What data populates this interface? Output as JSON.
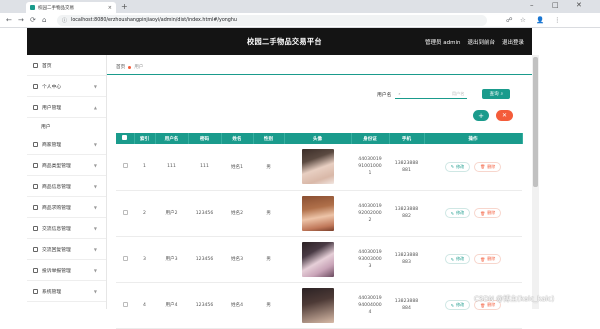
{
  "browser": {
    "tab_title": "校园二手物品交易",
    "tab_close": "×",
    "new_tab": "+",
    "window_controls": [
      "–",
      "□",
      "✕"
    ],
    "nav": [
      "←",
      "→",
      "⟳",
      "⌂"
    ],
    "lock": "ⓘ",
    "url": "localhost:8080/erzhoushangpinjiaoyi/admin/dist/index.html#/yonghu",
    "right_icons": [
      "☍",
      "☆",
      "👤",
      "⋮"
    ]
  },
  "header": {
    "title": "校园二手物品交易平台",
    "links": [
      "管理员 admin",
      "退出到前台",
      "退出登录"
    ]
  },
  "sidebar": {
    "items": [
      {
        "label": "首页",
        "has_chevron": false
      },
      {
        "label": "个人中心",
        "has_chevron": true
      },
      {
        "label": "用户管理",
        "has_chevron": true,
        "subitems": [
          "用户"
        ]
      },
      {
        "label": "商家管理",
        "has_chevron": true
      },
      {
        "label": "商品类型管理",
        "has_chevron": true
      },
      {
        "label": "商品信息管理",
        "has_chevron": true
      },
      {
        "label": "商品求购管理",
        "has_chevron": true
      },
      {
        "label": "交流信息管理",
        "has_chevron": true
      },
      {
        "label": "交流回复管理",
        "has_chevron": true
      },
      {
        "label": "投诉举报管理",
        "has_chevron": true
      },
      {
        "label": "系统管理",
        "has_chevron": true
      }
    ]
  },
  "breadcrumb": {
    "home": "首页",
    "current": "用户"
  },
  "search": {
    "label": "用户名",
    "placeholder": "用户名",
    "icon": "⌕",
    "button": "查询",
    "button_icon": "⌕"
  },
  "actions": {
    "add": "+",
    "delete": "✕"
  },
  "table": {
    "columns": [
      "",
      "索引",
      "用户名",
      "密码",
      "姓名",
      "性别",
      "头像",
      "身份证",
      "手机",
      "操作"
    ],
    "rows": [
      {
        "index": "1",
        "username": "111",
        "password": "111",
        "name": "姓名1",
        "gender": "男",
        "idcard": "44030019910010001",
        "phone": "13823888881",
        "avatar": "av1"
      },
      {
        "index": "2",
        "username": "用户2",
        "password": "123456",
        "name": "姓名2",
        "gender": "男",
        "idcard": "44030019920020002",
        "phone": "13823888882",
        "avatar": "av2"
      },
      {
        "index": "3",
        "username": "用户3",
        "password": "123456",
        "name": "姓名3",
        "gender": "男",
        "idcard": "44030019930030003",
        "phone": "13823888883",
        "avatar": "av3"
      },
      {
        "index": "4",
        "username": "用户4",
        "password": "123456",
        "name": "姓名4",
        "gender": "男",
        "idcard": "44030019940040004",
        "phone": "13823888884",
        "avatar": "av4"
      }
    ],
    "op_edit": "修改",
    "op_delete": "删除",
    "op_edit_icon": "✎",
    "op_delete_icon": "🗑"
  },
  "watermark": "CSDN @博主(kalc_kalc)",
  "colors": {
    "accent": "#1a9b8c",
    "danger": "#f45c3a",
    "header_bg": "#141414"
  }
}
